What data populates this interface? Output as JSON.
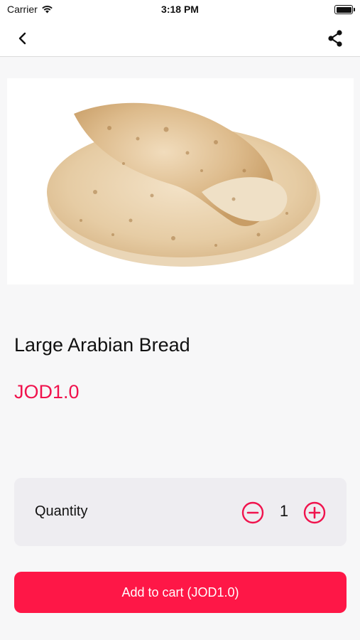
{
  "status_bar": {
    "carrier": "Carrier",
    "time": "3:18 PM"
  },
  "nav": {
    "back_icon": "chevron-left-icon",
    "share_icon": "share-icon"
  },
  "product": {
    "title": "Large Arabian Bread",
    "price": "JOD1.0"
  },
  "quantity": {
    "label": "Quantity",
    "value": "1",
    "minus_icon": "minus-circle-icon",
    "plus_icon": "plus-circle-icon"
  },
  "cart": {
    "button_label": "Add to cart (JOD1.0)"
  },
  "colors": {
    "accent": "#fe1747",
    "price": "#f0134d",
    "background": "#f7f7f8",
    "quantity_bg": "#eeedf1"
  }
}
